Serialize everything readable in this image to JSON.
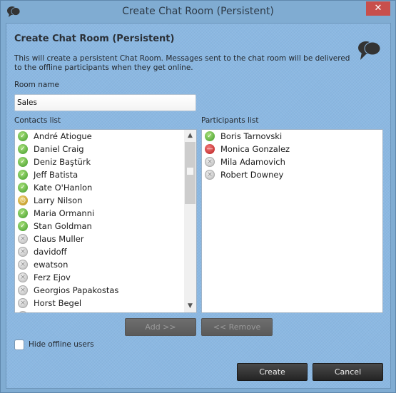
{
  "window": {
    "title": "Create Chat Room (Persistent)",
    "close_label": "✕"
  },
  "header": {
    "title": "Create Chat Room (Persistent)",
    "description": "This will create a persistent Chat Room. Messages sent to the chat room will be delivered to the offline participants when they get online."
  },
  "room_name": {
    "label": "Room name",
    "value": "Sales"
  },
  "contacts": {
    "label": "Contacts list",
    "items": [
      {
        "name": "André Atiogue",
        "status": "online"
      },
      {
        "name": "Daniel Craig",
        "status": "online"
      },
      {
        "name": "Deniz Baştürk",
        "status": "online"
      },
      {
        "name": "Jeff Batista",
        "status": "online"
      },
      {
        "name": "Kate O'Hanlon",
        "status": "online"
      },
      {
        "name": "Larry Nilson",
        "status": "away"
      },
      {
        "name": "Maria Ormanni",
        "status": "online"
      },
      {
        "name": "Stan Goldman",
        "status": "online"
      },
      {
        "name": "Claus Muller",
        "status": "offline"
      },
      {
        "name": "davidoff",
        "status": "offline"
      },
      {
        "name": "ewatson",
        "status": "offline"
      },
      {
        "name": "Ferz Ejov",
        "status": "offline"
      },
      {
        "name": "Georgios Papakostas",
        "status": "offline"
      },
      {
        "name": "Horst Begel",
        "status": "offline"
      },
      {
        "name": "",
        "status": "offline"
      }
    ]
  },
  "participants": {
    "label": "Participants list",
    "items": [
      {
        "name": "Boris Tarnovski",
        "status": "online"
      },
      {
        "name": "Monica Gonzalez",
        "status": "busy"
      },
      {
        "name": "Mila Adamovich",
        "status": "offline"
      },
      {
        "name": "Robert Downey",
        "status": "offline"
      }
    ]
  },
  "buttons": {
    "add": "Add >>",
    "remove": "<< Remove",
    "create": "Create",
    "cancel": "Cancel"
  },
  "hide_offline": {
    "label": "Hide offline users",
    "checked": false
  },
  "icons": {
    "online": "check-mark",
    "away": "clock",
    "busy": "minus",
    "offline": "x-mark",
    "scroll_up": "▲",
    "scroll_down": "▼"
  }
}
